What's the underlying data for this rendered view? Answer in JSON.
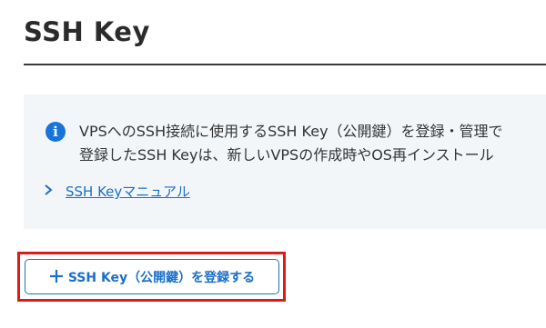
{
  "page": {
    "title": "SSH Key"
  },
  "info": {
    "icon": "info-icon",
    "icon_glyph": "i",
    "line1": "VPSへのSSH接続に使用するSSH Key（公開鍵）を登録・管理で",
    "line2": "登録したSSH Keyは、新しいVPSの作成時やOS再インストール"
  },
  "manual_link": {
    "icon": "chevron-right-icon",
    "label": "SSH Keyマニュアル"
  },
  "register_button": {
    "icon": "plus-icon",
    "label": "SSH Key（公開鍵）を登録する"
  },
  "colors": {
    "accent": "#1a6fc9",
    "info_icon": "#1a73d9",
    "panel_bg": "#f3f6f9",
    "highlight": "#e01919",
    "title_text": "#2b2b2b"
  }
}
